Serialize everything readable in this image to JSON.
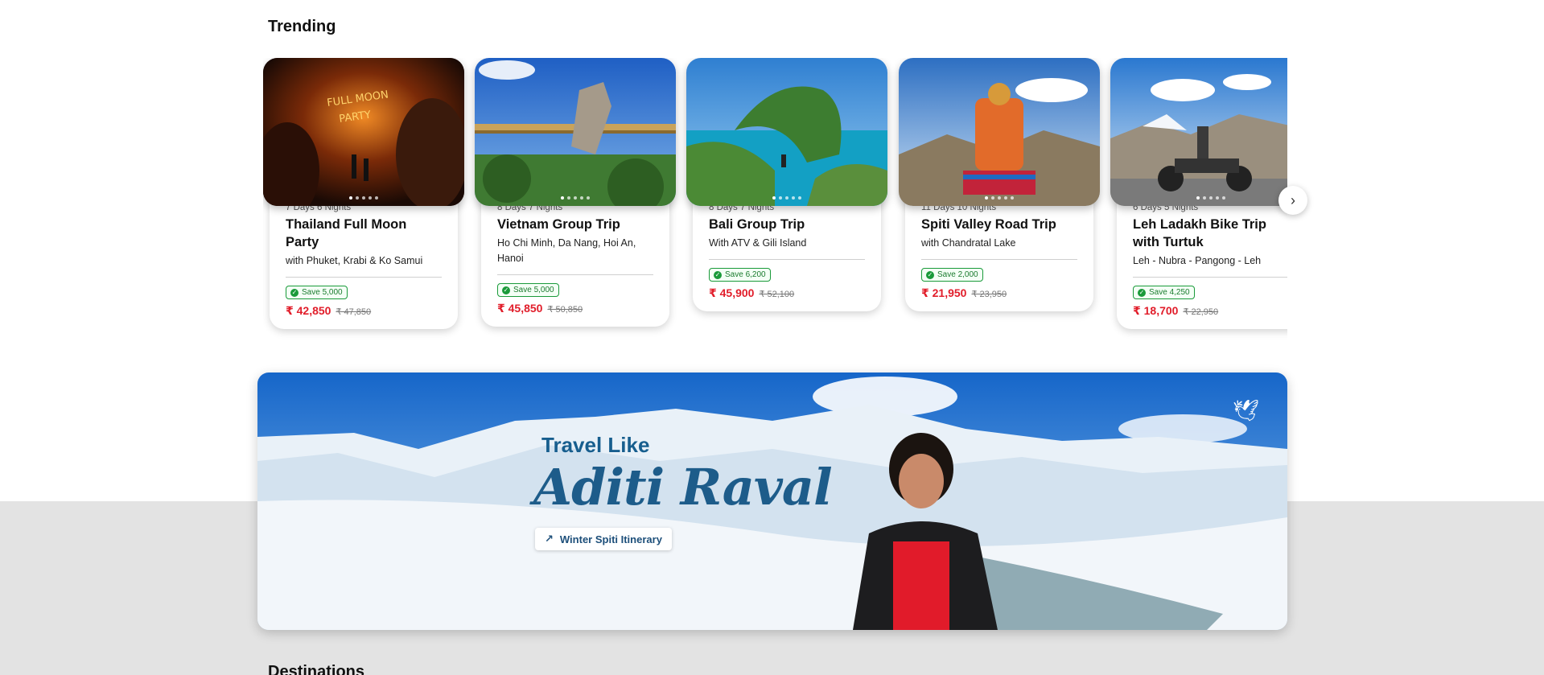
{
  "trending": {
    "title": "Trending",
    "cards": [
      {
        "duration": "7 Days 6 Nights",
        "name": "Thailand Full Moon Party",
        "sub": "with Phuket, Krabi & Ko Samui",
        "save": "Save 5,000",
        "price": "₹ 42,850",
        "old": "₹ 47,850",
        "image": "full-moon-party-photo"
      },
      {
        "duration": "8 Days 7 Nights",
        "name": "Vietnam Group Trip",
        "sub": "Ho Chi Minh, Da Nang, Hoi An, Hanoi",
        "save": "Save 5,000",
        "price": "₹ 45,850",
        "old": "₹ 50,850",
        "image": "golden-bridge-photo"
      },
      {
        "duration": "8 Days 7 Nights",
        "name": "Bali Group Trip",
        "sub": "With ATV & Gili Island",
        "save": "Save 6,200",
        "price": "₹ 45,900",
        "old": "₹ 52,100",
        "image": "kelingking-beach-photo"
      },
      {
        "duration": "11 Days 10 Nights",
        "name": "Spiti Valley Road Trip",
        "sub": "with Chandratal Lake",
        "save": "Save 2,000",
        "price": "₹ 21,950",
        "old": "₹ 23,950",
        "image": "buddha-statue-photo"
      },
      {
        "duration": "6 Days 5 Nights",
        "name": "Leh Ladakh Bike Trip with Turtuk",
        "sub": "Leh - Nubra - Pangong - Leh",
        "save": "Save 4,250",
        "price": "₹ 18,700",
        "old": "₹ 22,950",
        "image": "motorbike-mountains-photo"
      }
    ],
    "next_icon": "chevron-right-icon"
  },
  "banner": {
    "eyebrow": "Travel Like",
    "name": "Aditi Raval",
    "button": "Winter Spiti Itinerary",
    "button_icon": "arrow-up-right-icon",
    "logo_icon": "bird-logo-icon"
  },
  "destinations": {
    "title": "Destinations"
  },
  "colors": {
    "price": "#e11d2a",
    "save_green": "#1a9a3a",
    "banner_text": "#1d5c8a"
  }
}
